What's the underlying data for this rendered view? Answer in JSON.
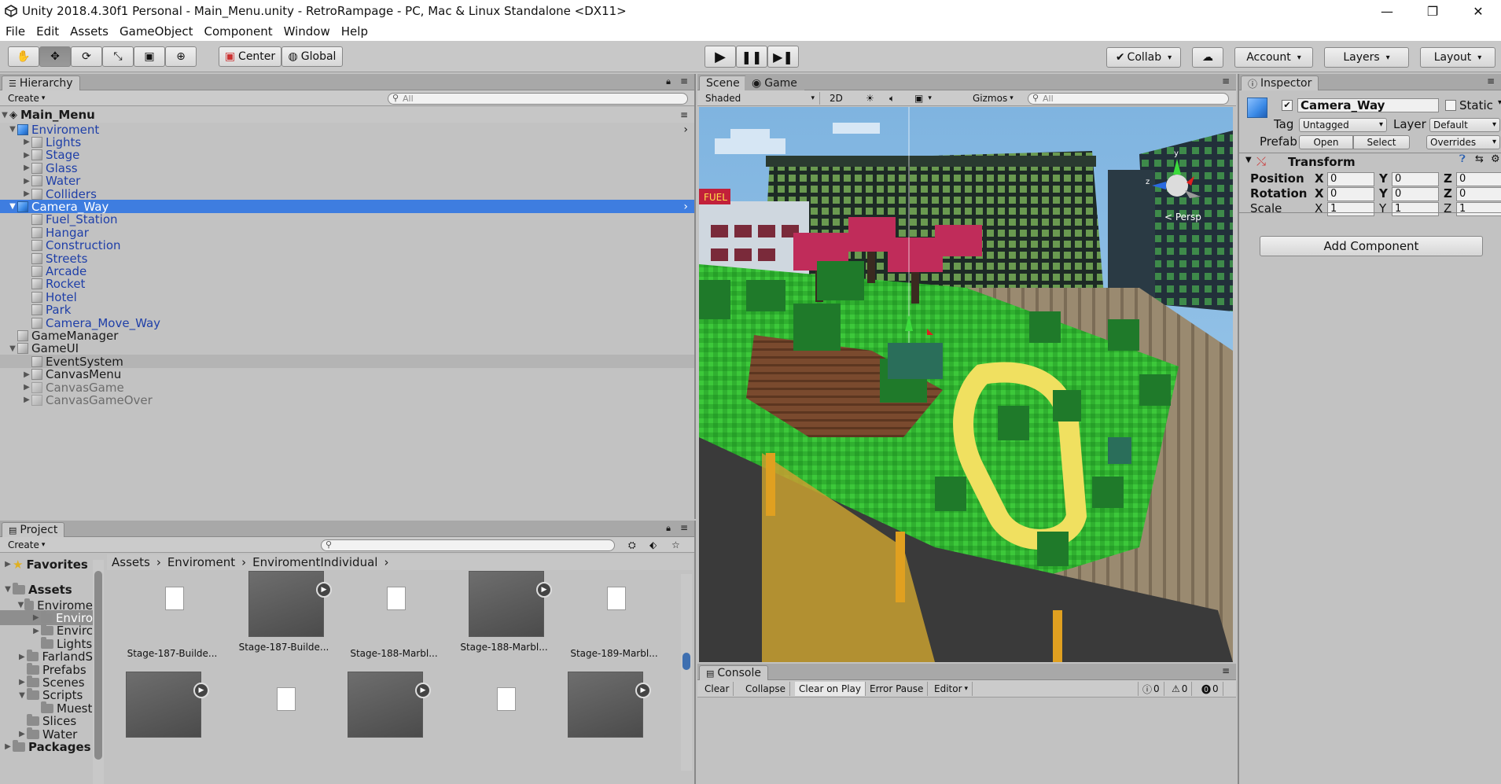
{
  "titlebar": {
    "title": "Unity 2018.4.30f1 Personal - Main_Menu.unity - RetroRampage - PC, Mac & Linux Standalone <DX11>",
    "minimize": "—",
    "restore": "❐",
    "close": "✕"
  },
  "menu": [
    "File",
    "Edit",
    "Assets",
    "GameObject",
    "Component",
    "Window",
    "Help"
  ],
  "toolbar": {
    "pivot_center": "Center",
    "pivot_global": "Global",
    "collab": "Collab",
    "account": "Account",
    "layers": "Layers",
    "layout": "Layout"
  },
  "hierarchy": {
    "tab": "Hierarchy",
    "create": "Create",
    "search_placeholder": "All",
    "scene": "Main_Menu",
    "rows": [
      {
        "label": "Enviroment"
      },
      {
        "label": "Lights"
      },
      {
        "label": "Stage"
      },
      {
        "label": "Glass"
      },
      {
        "label": "Water"
      },
      {
        "label": "Colliders"
      },
      {
        "label": "Camera_Way"
      },
      {
        "label": "Fuel_Station"
      },
      {
        "label": "Hangar"
      },
      {
        "label": "Construction"
      },
      {
        "label": "Streets"
      },
      {
        "label": "Arcade"
      },
      {
        "label": "Rocket"
      },
      {
        "label": "Hotel"
      },
      {
        "label": "Park"
      },
      {
        "label": "Camera_Move_Way"
      },
      {
        "label": "GameManager"
      },
      {
        "label": "GameUI"
      },
      {
        "label": "EventSystem"
      },
      {
        "label": "CanvasMenu"
      },
      {
        "label": "CanvasGame"
      },
      {
        "label": "CanvasGameOver"
      }
    ]
  },
  "scene": {
    "tab_scene": "Scene",
    "tab_game": "Game",
    "shading": "Shaded",
    "mode_2d": "2D",
    "gizmos": "Gizmos",
    "search_placeholder": "All",
    "persp": "< Persp",
    "gizmo_y": "y",
    "gizmo_z": "z",
    "sign": "FUEL"
  },
  "inspector": {
    "tab": "Inspector",
    "object_name": "Camera_Way",
    "static": "Static",
    "tag_label": "Tag",
    "tag_value": "Untagged",
    "layer_label": "Layer",
    "layer_value": "Default",
    "prefab_label": "Prefab",
    "open": "Open",
    "select": "Select",
    "overrides": "Overrides",
    "transform": "Transform",
    "position_label": "Position",
    "rotation_label": "Rotation",
    "scale_label": "Scale",
    "axis_x": "X",
    "axis_y": "Y",
    "axis_z": "Z",
    "position": [
      "0",
      "0",
      "0"
    ],
    "rotation": [
      "0",
      "0",
      "0"
    ],
    "scale": [
      "1",
      "1",
      "1"
    ],
    "add_component": "Add Component"
  },
  "project": {
    "tab": "Project",
    "create": "Create",
    "favorites": "Favorites",
    "assets": "Assets",
    "tree": [
      "Envirome",
      "Enviro",
      "Envirc",
      "Lights",
      "FarlandS",
      "Prefabs",
      "Scenes",
      "Scripts",
      "Muest",
      "Slices",
      "Water",
      "Packages"
    ],
    "breadcrumb": [
      "Assets",
      "Enviroment",
      "EnviromentIndividual"
    ],
    "items": [
      {
        "label": "Stage-187-Builde..."
      },
      {
        "label": "Stage-187-Builde..."
      },
      {
        "label": "Stage-188-Marbl..."
      },
      {
        "label": "Stage-188-Marbl..."
      },
      {
        "label": "Stage-189-Marbl..."
      }
    ]
  },
  "console": {
    "tab": "Console",
    "clear": "Clear",
    "collapse": "Collapse",
    "clear_on_play": "Clear on Play",
    "error_pause": "Error Pause",
    "editor": "Editor",
    "info_count": "0",
    "warn_count": "0",
    "error_count": "0"
  }
}
